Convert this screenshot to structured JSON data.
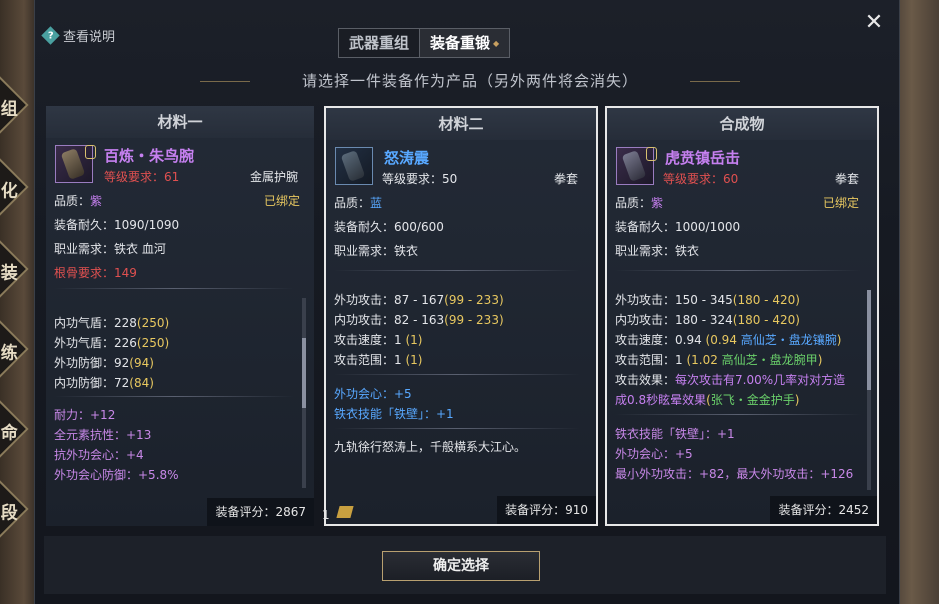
{
  "help": {
    "label": "查看说明"
  },
  "tabs": [
    {
      "label": "武器重组"
    },
    {
      "label": "装备重锻"
    }
  ],
  "subtitle": "请选择一件装备作为产品（另外两件将会消失）",
  "left_deco": [
    "组",
    "化",
    "装",
    "练",
    "命",
    "段"
  ],
  "cards": [
    {
      "header": "材料一",
      "name": "百炼・朱鸟腕",
      "level": "等级要求：61",
      "type": "金属护腕",
      "quality_label": "品质：",
      "quality": "紫",
      "bound": "已绑定",
      "durability": "装备耐久：1090/1090",
      "job": "职业需求：铁衣 血河",
      "bone": "根骨要求：149",
      "stats": [
        {
          "label": "内功气盾：228",
          "extra": "(250)"
        },
        {
          "label": "外功气盾：226",
          "extra": "(250)"
        },
        {
          "label": "外功防御：92",
          "extra": "(94)"
        },
        {
          "label": "内功防御：72",
          "extra": "(84)"
        }
      ],
      "extras": [
        "耐力：+12",
        "全元素抗性：+13",
        "抗外功会心：+4",
        "外功会心防御：+5.8%"
      ],
      "score": "装备评分：2867"
    },
    {
      "header": "材料二",
      "name": "怒涛震",
      "level": "等级要求：50",
      "type": "拳套",
      "quality_label": "品质：",
      "quality": "蓝",
      "durability": "装备耐久：600/600",
      "job": "职业需求：铁衣",
      "stats": [
        {
          "label": "外功攻击：87 - 167",
          "extra": "(99 - 233)"
        },
        {
          "label": "内功攻击：82 - 163",
          "extra": "(99 - 233)"
        },
        {
          "label": "攻击速度：1",
          "extra": " (1)"
        },
        {
          "label": "攻击范围：1",
          "extra": " (1)"
        }
      ],
      "extras": [
        "外功会心：+5",
        "铁衣技能「铁壁」：+1"
      ],
      "flavor": "九轨徐行怒涛上，千般横系大江心。",
      "count": "1",
      "score": "装备评分：910"
    },
    {
      "header": "合成物",
      "name": "虎贲镇岳击",
      "level": "等级要求：60",
      "type": "拳套",
      "quality_label": "品质：",
      "quality": "紫",
      "bound": "已绑定",
      "durability": "装备耐久：1000/1000",
      "job": "职业需求：铁衣",
      "stats": [
        {
          "label": "外功攻击：150 - 345",
          "extra": "(180 - 420)"
        },
        {
          "label": "内功攻击：180 - 324",
          "extra": "(180 - 420)"
        }
      ],
      "speed": {
        "label": "攻击速度：0.94",
        "extra": " (0.94 ",
        "set": "高仙芝・盘龙镶腕",
        "close": ")"
      },
      "range": {
        "label": "攻击范围：1",
        "extra": " (1.02 ",
        "set": "高仙芝・盘龙腕甲",
        "close": ")"
      },
      "effect": {
        "label": "攻击效果：",
        "text1": "每次攻击有7.00%几率对对方造",
        "text2": "成0.8秒眩晕效果",
        "set": "张飞・金金护手",
        "close": ")",
        "open": "("
      },
      "extras": [
        "铁衣技能「铁壁」：+1",
        "外功会心：+5",
        "最小外功攻击：+82，最大外功攻击：+126"
      ],
      "score": "装备评分：2452"
    }
  ],
  "confirm": "确定选择",
  "close": "✕"
}
